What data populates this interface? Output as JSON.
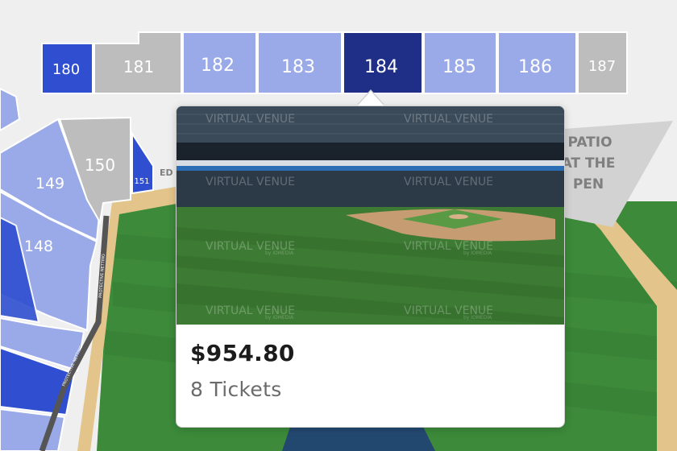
{
  "colors": {
    "background": "#efefef",
    "field_grass": "#3c8a3a",
    "warning_track": "#e3c48a",
    "section_light": "#9aaae8",
    "section_mid": "#7a90e0",
    "section_bright": "#2f4fd0",
    "section_selected": "#1f2f87",
    "section_unavailable": "#bdbdbd"
  },
  "sections": {
    "s180": "180",
    "s181": "181",
    "s182": "182",
    "s183": "183",
    "s184": "184",
    "s185": "185",
    "s186": "186",
    "s187": "187",
    "s149": "149",
    "s150": "150",
    "s151": "151",
    "s148": "148"
  },
  "map_labels": {
    "patio_line1": "PATIO",
    "patio_line2": "AT THE",
    "patio_line3": "PEN",
    "edge_label": "ED",
    "netting_1": "PROTECTIVE NETTING",
    "netting_2": "PROTECTIVE NETTING"
  },
  "selected_section": "184",
  "popup": {
    "price": "$954.80",
    "tickets": "8 Tickets",
    "view_watermark": "VIRTUAL VENUE",
    "view_watermark_sub": "by IOMEDIA"
  }
}
